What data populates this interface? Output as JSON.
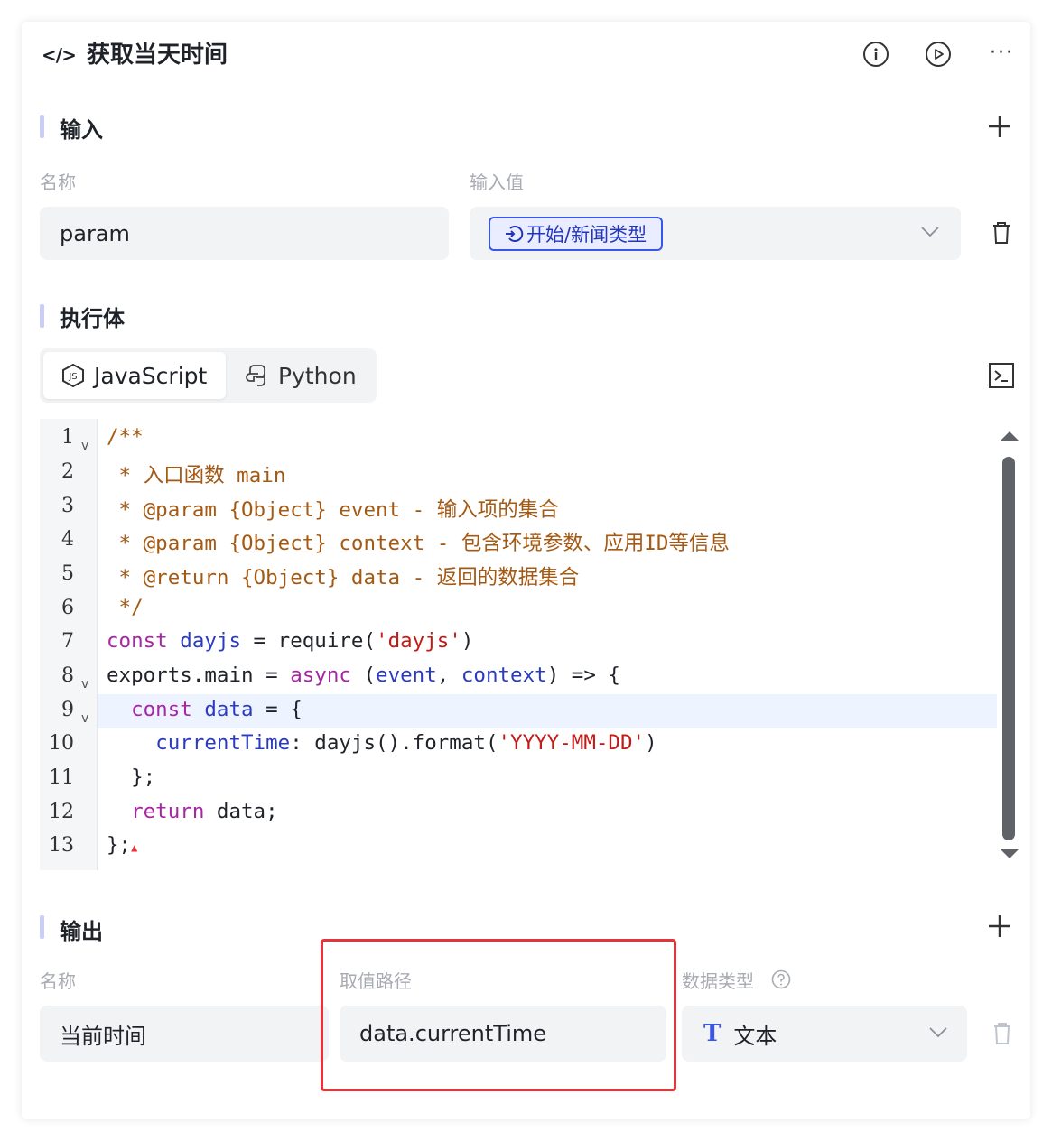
{
  "header": {
    "title": "获取当天时间",
    "code_icon_glyph": "</>",
    "more_glyph": "···"
  },
  "input_section": {
    "title": "输入",
    "name_label": "名称",
    "value_label": "输入值",
    "param_name": "param",
    "param_value_tag": "开始/新闻类型"
  },
  "exec_section": {
    "title": "执行体",
    "tabs": [
      {
        "label": "JavaScript",
        "active": true
      },
      {
        "label": "Python",
        "active": false
      }
    ]
  },
  "code": {
    "line_numbers": [
      "1",
      "2",
      "3",
      "4",
      "5",
      "6",
      "7",
      "8",
      "9",
      "10",
      "11",
      "12",
      "13"
    ],
    "active_line": 9
  },
  "output_section": {
    "title": "输出",
    "name_label": "名称",
    "path_label": "取值路径",
    "type_label": "数据类型",
    "output_name": "当前时间",
    "output_path": "data.currentTime",
    "type_icon_glyph": "T",
    "type_value": "文本"
  },
  "colors": {
    "accent_border": "#3a56e8",
    "highlight_red": "#e8333b",
    "section_bar": "#c9cef9"
  }
}
